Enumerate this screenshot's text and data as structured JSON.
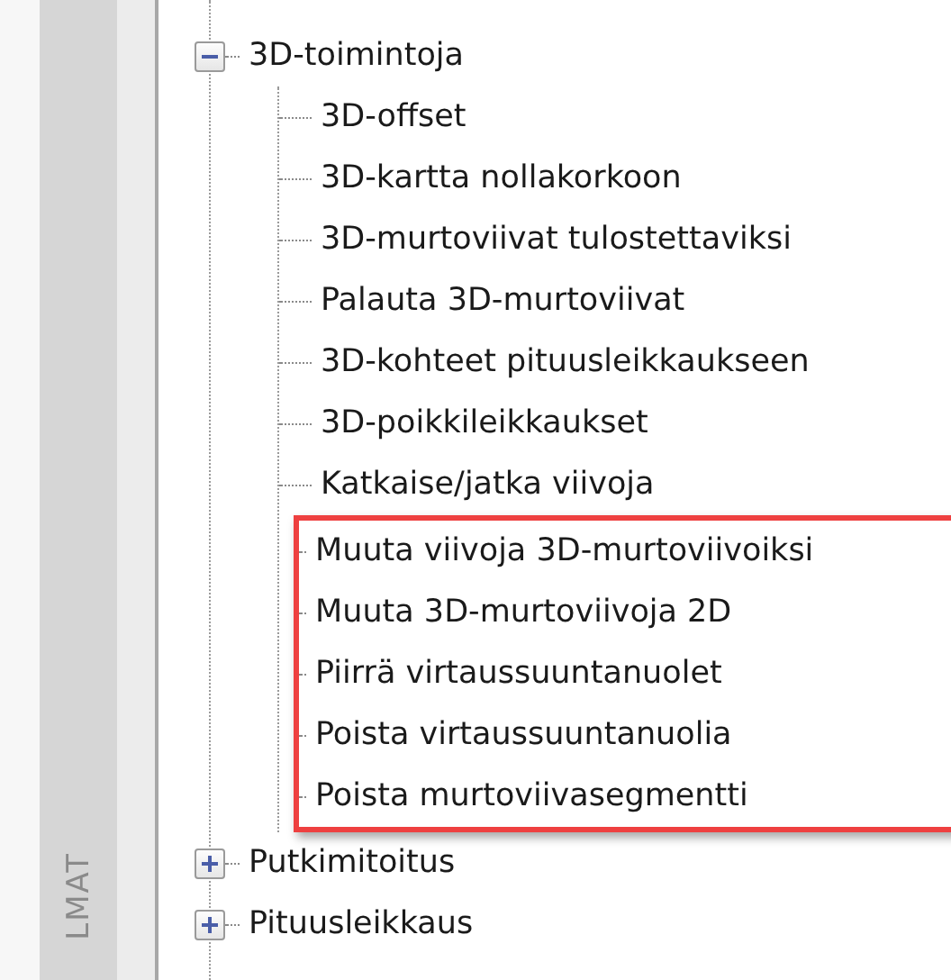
{
  "side_panel": {
    "label": "LMAT"
  },
  "tree": [
    {
      "label": "3D-toimintoja",
      "expanded": true,
      "children": [
        {
          "label": "3D-offset",
          "highlighted": false
        },
        {
          "label": "3D-kartta nollakorkoon",
          "highlighted": false
        },
        {
          "label": "3D-murtoviivat tulostettaviksi",
          "highlighted": false
        },
        {
          "label": "Palauta 3D-murtoviivat",
          "highlighted": false
        },
        {
          "label": "3D-kohteet pituusleikkaukseen",
          "highlighted": false
        },
        {
          "label": "3D-poikkileikkaukset",
          "highlighted": false
        },
        {
          "label": "Katkaise/jatka viivoja",
          "highlighted": false
        },
        {
          "label": "Muuta viivoja 3D-murtoviivoiksi",
          "highlighted": true
        },
        {
          "label": "Muuta 3D-murtoviivoja 2D",
          "highlighted": true
        },
        {
          "label": "Piirrä virtaussuuntanuolet",
          "highlighted": true
        },
        {
          "label": "Poista virtaussuuntanuolia",
          "highlighted": true
        },
        {
          "label": "Poista murtoviivasegmentti",
          "highlighted": true
        }
      ]
    },
    {
      "label": "Putkimitoitus",
      "expanded": false
    },
    {
      "label": "Pituusleikkaus",
      "expanded": false
    }
  ]
}
